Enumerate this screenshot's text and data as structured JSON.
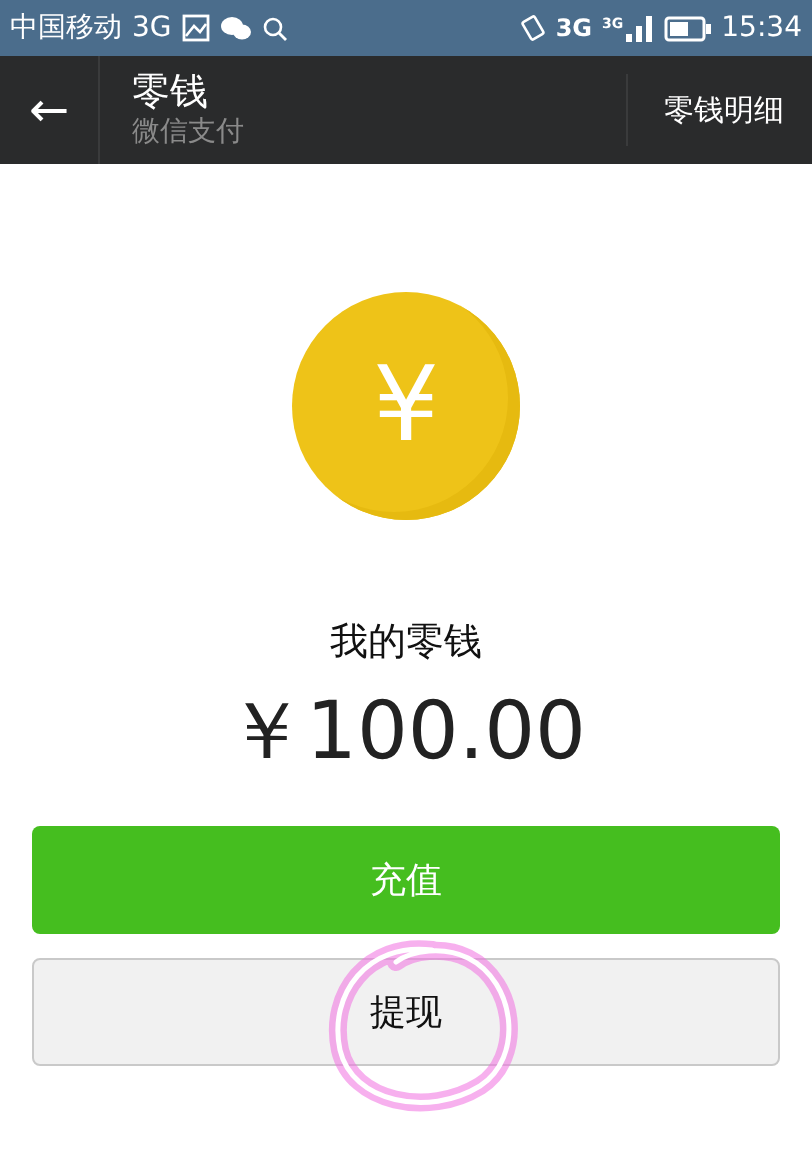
{
  "status_bar": {
    "carrier": "中国移动",
    "network": "3G",
    "network_right": "3G",
    "signal_type": "3G",
    "time": "15:34"
  },
  "header": {
    "back": "←",
    "title": "零钱",
    "subtitle": "微信支付",
    "action": "零钱明细"
  },
  "balance": {
    "coin_symbol": "¥",
    "label": "我的零钱",
    "amount": "￥100.00"
  },
  "buttons": [
    {
      "label": "充值",
      "kind": "primary"
    },
    {
      "label": "提现",
      "kind": "secondary",
      "highlighted": true
    }
  ]
}
